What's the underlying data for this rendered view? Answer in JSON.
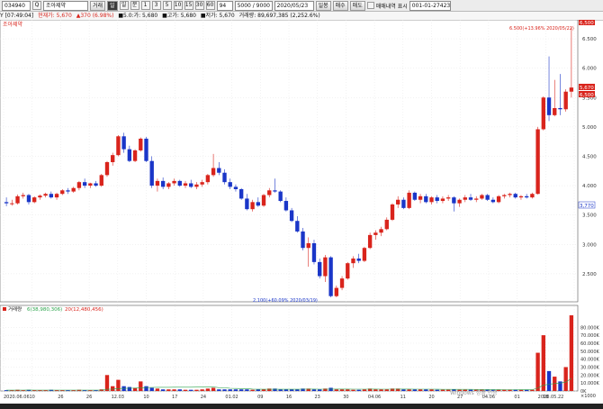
{
  "toolbar": {
    "code": "034940",
    "search_label": "Q",
    "stock_name": "조아제약",
    "item_period": "거래",
    "mode": "일",
    "per_btn": "일",
    "min_btn": "분",
    "tick_btns": [
      "1",
      "3",
      "5",
      "10",
      "15",
      "30",
      "60"
    ],
    "count": "94",
    "range": "5000 / 9000",
    "date": "2020/05/23",
    "tab1": "일봉",
    "buy_btn": "매수",
    "sell_btn": "매도",
    "checkbox_label": "매매내역 표시",
    "account": "001-01-274238"
  },
  "infobar": {
    "clock": "Y [07:49:04]",
    "price": "현재가: 5,670",
    "change": "▲370 (6.98%)",
    "open": "■5.0:가: 5,680",
    "high": "■고가: 5,680",
    "low": "■저가: 5,670",
    "volume": "거래량: 89,697,385 (2,252.6%)"
  },
  "chart": {
    "series_name": "조아제약",
    "y_ticks": [
      "6.500",
      "6.000",
      "5.500",
      "5.000",
      "4.500",
      "4.000",
      "3.500",
      "3.000",
      "2.500"
    ],
    "high_marker": "6.500(+13.96% 2020/05/22)",
    "low_marker": "2,100(+60.09% 2020/03/19)",
    "top_value": "6,500",
    "current_value": "5,670",
    "current_value2": "6,500",
    "min_tag": "3,770",
    "volume_legend_name": "거래량",
    "volume_legend_ma1": "6(38,980,306)",
    "volume_legend_ma2": "20(12,480,456)",
    "volume_ticks": [
      "80.000K",
      "70.000K",
      "60.000K",
      "50.000K",
      "40.000K",
      "30.000K",
      "20.000K",
      "10.000K",
      "0K"
    ],
    "volume_unit": "×1000",
    "x_labels": [
      "2020.06.06",
      "10",
      "26",
      "26",
      "12.03",
      "10",
      "17",
      "24",
      "01.02",
      "09",
      "16",
      "23",
      "30",
      "04.06",
      "11",
      "20",
      "27",
      "04.06",
      "01",
      "18",
      "2020.05.22"
    ],
    "watermark": "Windows 정품 인증",
    "colors": {
      "up": "#d9241c",
      "down": "#1a36c8",
      "ma": "#2aa34a",
      "grid": "#e6e6e6"
    }
  },
  "chart_data": {
    "type": "candlestick",
    "title": "조아제약",
    "ylim": [
      2100,
      6700
    ],
    "candles": [
      [
        3720,
        3800,
        3650,
        3700
      ],
      [
        3700,
        3760,
        3660,
        3700
      ],
      [
        3700,
        3850,
        3680,
        3820
      ],
      [
        3820,
        3880,
        3780,
        3840
      ],
      [
        3840,
        3860,
        3680,
        3720
      ],
      [
        3720,
        3820,
        3700,
        3800
      ],
      [
        3800,
        3850,
        3760,
        3830
      ],
      [
        3830,
        3880,
        3800,
        3860
      ],
      [
        3860,
        3900,
        3780,
        3800
      ],
      [
        3800,
        3880,
        3760,
        3860
      ],
      [
        3860,
        3940,
        3840,
        3920
      ],
      [
        3920,
        3960,
        3860,
        3900
      ],
      [
        3900,
        3980,
        3880,
        3960
      ],
      [
        3960,
        4080,
        3920,
        4060
      ],
      [
        4060,
        4120,
        3960,
        4000
      ],
      [
        4000,
        4050,
        3960,
        4040
      ],
      [
        4040,
        4080,
        3980,
        4000
      ],
      [
        4000,
        4200,
        3980,
        4180
      ],
      [
        4180,
        4420,
        4150,
        4400
      ],
      [
        4400,
        4560,
        4340,
        4520
      ],
      [
        4520,
        4860,
        4500,
        4840
      ],
      [
        4840,
        4900,
        4560,
        4620
      ],
      [
        4620,
        4680,
        4400,
        4420
      ],
      [
        4420,
        4620,
        4400,
        4600
      ],
      [
        4600,
        4820,
        4580,
        4800
      ],
      [
        4800,
        4830,
        4400,
        4420
      ],
      [
        4420,
        4500,
        3960,
        4000
      ],
      [
        4000,
        4120,
        3900,
        4080
      ],
      [
        4080,
        4140,
        3940,
        3980
      ],
      [
        3980,
        4060,
        3940,
        4040
      ],
      [
        4040,
        4120,
        4000,
        4080
      ],
      [
        4080,
        4100,
        3980,
        4000
      ],
      [
        4000,
        4080,
        3960,
        4040
      ],
      [
        4040,
        4100,
        3960,
        3980
      ],
      [
        3980,
        4060,
        3940,
        4020
      ],
      [
        4020,
        4100,
        3980,
        4060
      ],
      [
        4060,
        4200,
        4020,
        4180
      ],
      [
        4180,
        4540,
        4150,
        4300
      ],
      [
        4300,
        4400,
        4180,
        4220
      ],
      [
        4220,
        4280,
        4020,
        4060
      ],
      [
        4060,
        4120,
        3940,
        3980
      ],
      [
        3980,
        4020,
        3900,
        3940
      ],
      [
        3940,
        3960,
        3760,
        3780
      ],
      [
        3780,
        3860,
        3580,
        3600
      ],
      [
        3600,
        3760,
        3560,
        3720
      ],
      [
        3720,
        3800,
        3640,
        3660
      ],
      [
        3660,
        3860,
        3640,
        3840
      ],
      [
        3840,
        3960,
        3800,
        3920
      ],
      [
        3920,
        4120,
        3880,
        3900
      ],
      [
        3900,
        3920,
        3720,
        3740
      ],
      [
        3740,
        3800,
        3560,
        3580
      ],
      [
        3580,
        3620,
        3380,
        3400
      ],
      [
        3400,
        3480,
        3200,
        3220
      ],
      [
        3220,
        3280,
        2900,
        2940
      ],
      [
        2940,
        3120,
        2620,
        3020
      ],
      [
        3020,
        3080,
        2660,
        2700
      ],
      [
        2700,
        2760,
        2420,
        2460
      ],
      [
        2460,
        2820,
        2360,
        2780
      ],
      [
        2780,
        2800,
        2100,
        2120
      ],
      [
        2120,
        2300,
        2100,
        2260
      ],
      [
        2260,
        2460,
        2220,
        2420
      ],
      [
        2420,
        2700,
        2400,
        2680
      ],
      [
        2680,
        2800,
        2600,
        2760
      ],
      [
        2760,
        2840,
        2680,
        2720
      ],
      [
        2720,
        2960,
        2700,
        2940
      ],
      [
        2940,
        3200,
        2920,
        3160
      ],
      [
        3160,
        3240,
        3080,
        3200
      ],
      [
        3200,
        3300,
        3140,
        3260
      ],
      [
        3260,
        3460,
        3240,
        3420
      ],
      [
        3420,
        3700,
        3400,
        3680
      ],
      [
        3680,
        3820,
        3620,
        3760
      ],
      [
        3760,
        3800,
        3600,
        3620
      ],
      [
        3620,
        3920,
        3600,
        3880
      ],
      [
        3880,
        3900,
        3740,
        3760
      ],
      [
        3760,
        3860,
        3700,
        3820
      ],
      [
        3820,
        3860,
        3700,
        3720
      ],
      [
        3720,
        3820,
        3680,
        3800
      ],
      [
        3800,
        3840,
        3700,
        3740
      ],
      [
        3740,
        3820,
        3700,
        3780
      ],
      [
        3780,
        3840,
        3740,
        3800
      ],
      [
        3800,
        3820,
        3560,
        3700
      ],
      [
        3700,
        3780,
        3640,
        3760
      ],
      [
        3760,
        3840,
        3720,
        3800
      ],
      [
        3800,
        3860,
        3740,
        3760
      ],
      [
        3760,
        3820,
        3720,
        3780
      ],
      [
        3780,
        3860,
        3760,
        3840
      ],
      [
        3840,
        3860,
        3740,
        3760
      ],
      [
        3760,
        3800,
        3700,
        3720
      ],
      [
        3720,
        3840,
        3700,
        3820
      ],
      [
        3820,
        3860,
        3780,
        3840
      ],
      [
        3840,
        3880,
        3800,
        3860
      ],
      [
        3860,
        3880,
        3780,
        3800
      ],
      [
        3800,
        3840,
        3760,
        3820
      ],
      [
        3820,
        3860,
        3780,
        3800
      ],
      [
        3800,
        3880,
        3780,
        3860
      ],
      [
        3860,
        5000,
        3850,
        4960
      ],
      [
        4960,
        5520,
        4940,
        5500
      ],
      [
        5500,
        6200,
        5100,
        5200
      ],
      [
        5200,
        5800,
        5180,
        5320
      ],
      [
        5320,
        5900,
        5200,
        5300
      ],
      [
        5300,
        5640,
        5260,
        5600
      ],
      [
        5600,
        6700,
        5500,
        5670
      ]
    ],
    "volumes": [
      1,
      1,
      1.5,
      1,
      1.5,
      1,
      1,
      1,
      1.5,
      1,
      1,
      1,
      1,
      1.5,
      1,
      1,
      1,
      2,
      20,
      6,
      14,
      6,
      5,
      4,
      12,
      6,
      4,
      3,
      2,
      2,
      2,
      2,
      1.5,
      1.5,
      1.5,
      2,
      3,
      4,
      2,
      2,
      2,
      2,
      2,
      2,
      1.5,
      2,
      2,
      3,
      3,
      2,
      2,
      2,
      2,
      3,
      3,
      2,
      2,
      3,
      4,
      2,
      2,
      2,
      1.5,
      1.5,
      2,
      3,
      2,
      2,
      2,
      3,
      3,
      2,
      2,
      2,
      2,
      2,
      2,
      1.5,
      1.5,
      1.5,
      2,
      1.5,
      1.5,
      1.5,
      1.5,
      1.5,
      1.5,
      1.5,
      1.5,
      1.5,
      1.5,
      1.5,
      1.5,
      1.5,
      1.5,
      48,
      70,
      25,
      18,
      12,
      30,
      95
    ],
    "volume_ylim": [
      0,
      95
    ]
  }
}
